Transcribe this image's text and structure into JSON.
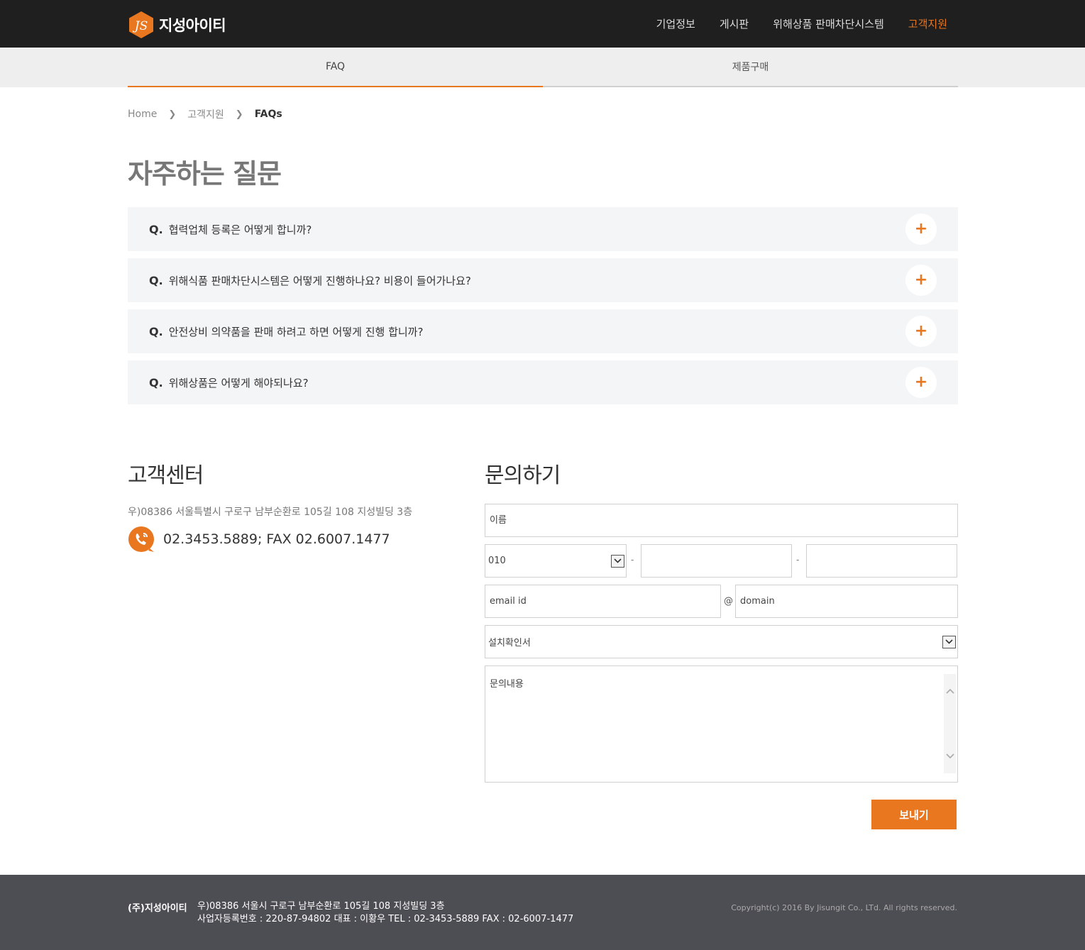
{
  "header": {
    "logo_mark": "JS",
    "logo_text": "지성아이티",
    "nav": [
      {
        "label": "기업정보"
      },
      {
        "label": "게시판"
      },
      {
        "label": "위해상품 판매차단시스템"
      },
      {
        "label": "고객지원",
        "active": true
      }
    ]
  },
  "colors": {
    "accent": "#e9771f",
    "header_bg": "#1f1f1f",
    "footer_bg": "#4d4d54"
  },
  "subnav": {
    "tabs": [
      {
        "label": "FAQ",
        "active": true
      },
      {
        "label": "제품구매"
      }
    ]
  },
  "breadcrumb": {
    "home": "Home",
    "section": "고객지원",
    "current": "FAQs"
  },
  "page": {
    "title": "자주하는 질문"
  },
  "faq": {
    "q_prefix": "Q.",
    "items": [
      {
        "question": "협력업체 등록은 어떻게 합니까?",
        "toggle": "+"
      },
      {
        "question": "위해식품 판매차단시스템은 어떻게 진행하나요? 비용이 들어가나요?",
        "toggle": "+"
      },
      {
        "question": "안전상비 의약품을 판매 하려고 하면 어떻게 진행 합니까?",
        "toggle": "+"
      },
      {
        "question": "위해상품은 어떻게 해야되나요?",
        "toggle": "+"
      }
    ]
  },
  "customer_center": {
    "title": "고객센터",
    "address": "우)08386 서울특별시 구로구 남부순환로 105길 108 지성빌딩 3층",
    "phone": "02.3453.5889; FAX 02.6007.1477",
    "phone_icon": "phone-icon"
  },
  "inquiry": {
    "title": "문의하기",
    "name_placeholder": "이름",
    "phone_prefix": "010",
    "phone_separator": "-",
    "email_id_placeholder": "email id",
    "email_at": "@",
    "email_domain_placeholder": "domain",
    "category_selected": "설치확인서",
    "content_placeholder": "문의내용",
    "submit_label": "보내기"
  },
  "footer": {
    "company": "(주)지성아이티",
    "address_line1": "우)08386 서울시 구로구 남부순환로 105길 108 지성빌딩 3층",
    "address_line2": "사업자등록번호 : 220-87-94802 대표 : 이황우 TEL : 02-3453-5889 FAX : 02-6007-1477",
    "copyright": "Copyright(c) 2016 By Jisungit Co., LTd. All rights reserved."
  }
}
